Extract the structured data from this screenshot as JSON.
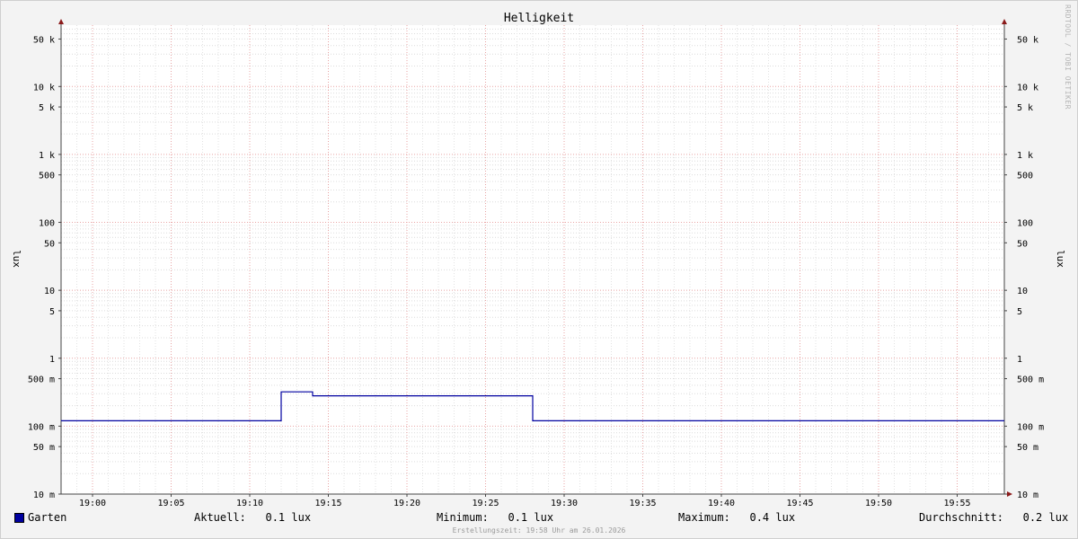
{
  "credit": "RRDTOOL / TOBI OETIKER",
  "chart_data": {
    "type": "line",
    "title": "Helligkeit",
    "ylabel": "lux",
    "yscale": "log",
    "ylim": [
      0.01,
      80000
    ],
    "yticks": [
      {
        "value": 50000,
        "label": "50 k"
      },
      {
        "value": 10000,
        "label": "10 k"
      },
      {
        "value": 5000,
        "label": "5 k"
      },
      {
        "value": 1000,
        "label": "1 k"
      },
      {
        "value": 500,
        "label": "500"
      },
      {
        "value": 100,
        "label": "100"
      },
      {
        "value": 50,
        "label": "50"
      },
      {
        "value": 10,
        "label": "10"
      },
      {
        "value": 5,
        "label": "5"
      },
      {
        "value": 1,
        "label": "1"
      },
      {
        "value": 0.5,
        "label": "500 m"
      },
      {
        "value": 0.1,
        "label": "100 m"
      },
      {
        "value": 0.05,
        "label": "50 m"
      },
      {
        "value": 0.01,
        "label": "10 m"
      }
    ],
    "xlim": [
      "18:58",
      "19:58"
    ],
    "xticks": [
      "19:00",
      "19:05",
      "19:10",
      "19:15",
      "19:20",
      "19:25",
      "19:30",
      "19:35",
      "19:40",
      "19:45",
      "19:50",
      "19:55"
    ],
    "grid": true,
    "series": [
      {
        "name": "Garten",
        "color": "#0000a0",
        "points": [
          [
            "18:58",
            0.12
          ],
          [
            "19:12",
            0.12
          ],
          [
            "19:12",
            0.32
          ],
          [
            "19:14",
            0.32
          ],
          [
            "19:14",
            0.28
          ],
          [
            "19:28",
            0.28
          ],
          [
            "19:28",
            0.12
          ],
          [
            "19:58",
            0.12
          ]
        ]
      }
    ]
  },
  "legend": {
    "series_name": "Garten",
    "swatch_color": "#0000a0",
    "current": "Aktuell:   0.1 lux",
    "minimum": "Minimum:   0.1 lux",
    "maximum": "Maximum:   0.4 lux",
    "average": "Durchschnitt:   0.2 lux"
  },
  "footer": "Erstellungszeit: 19:58 Uhr am 26.01.2026"
}
